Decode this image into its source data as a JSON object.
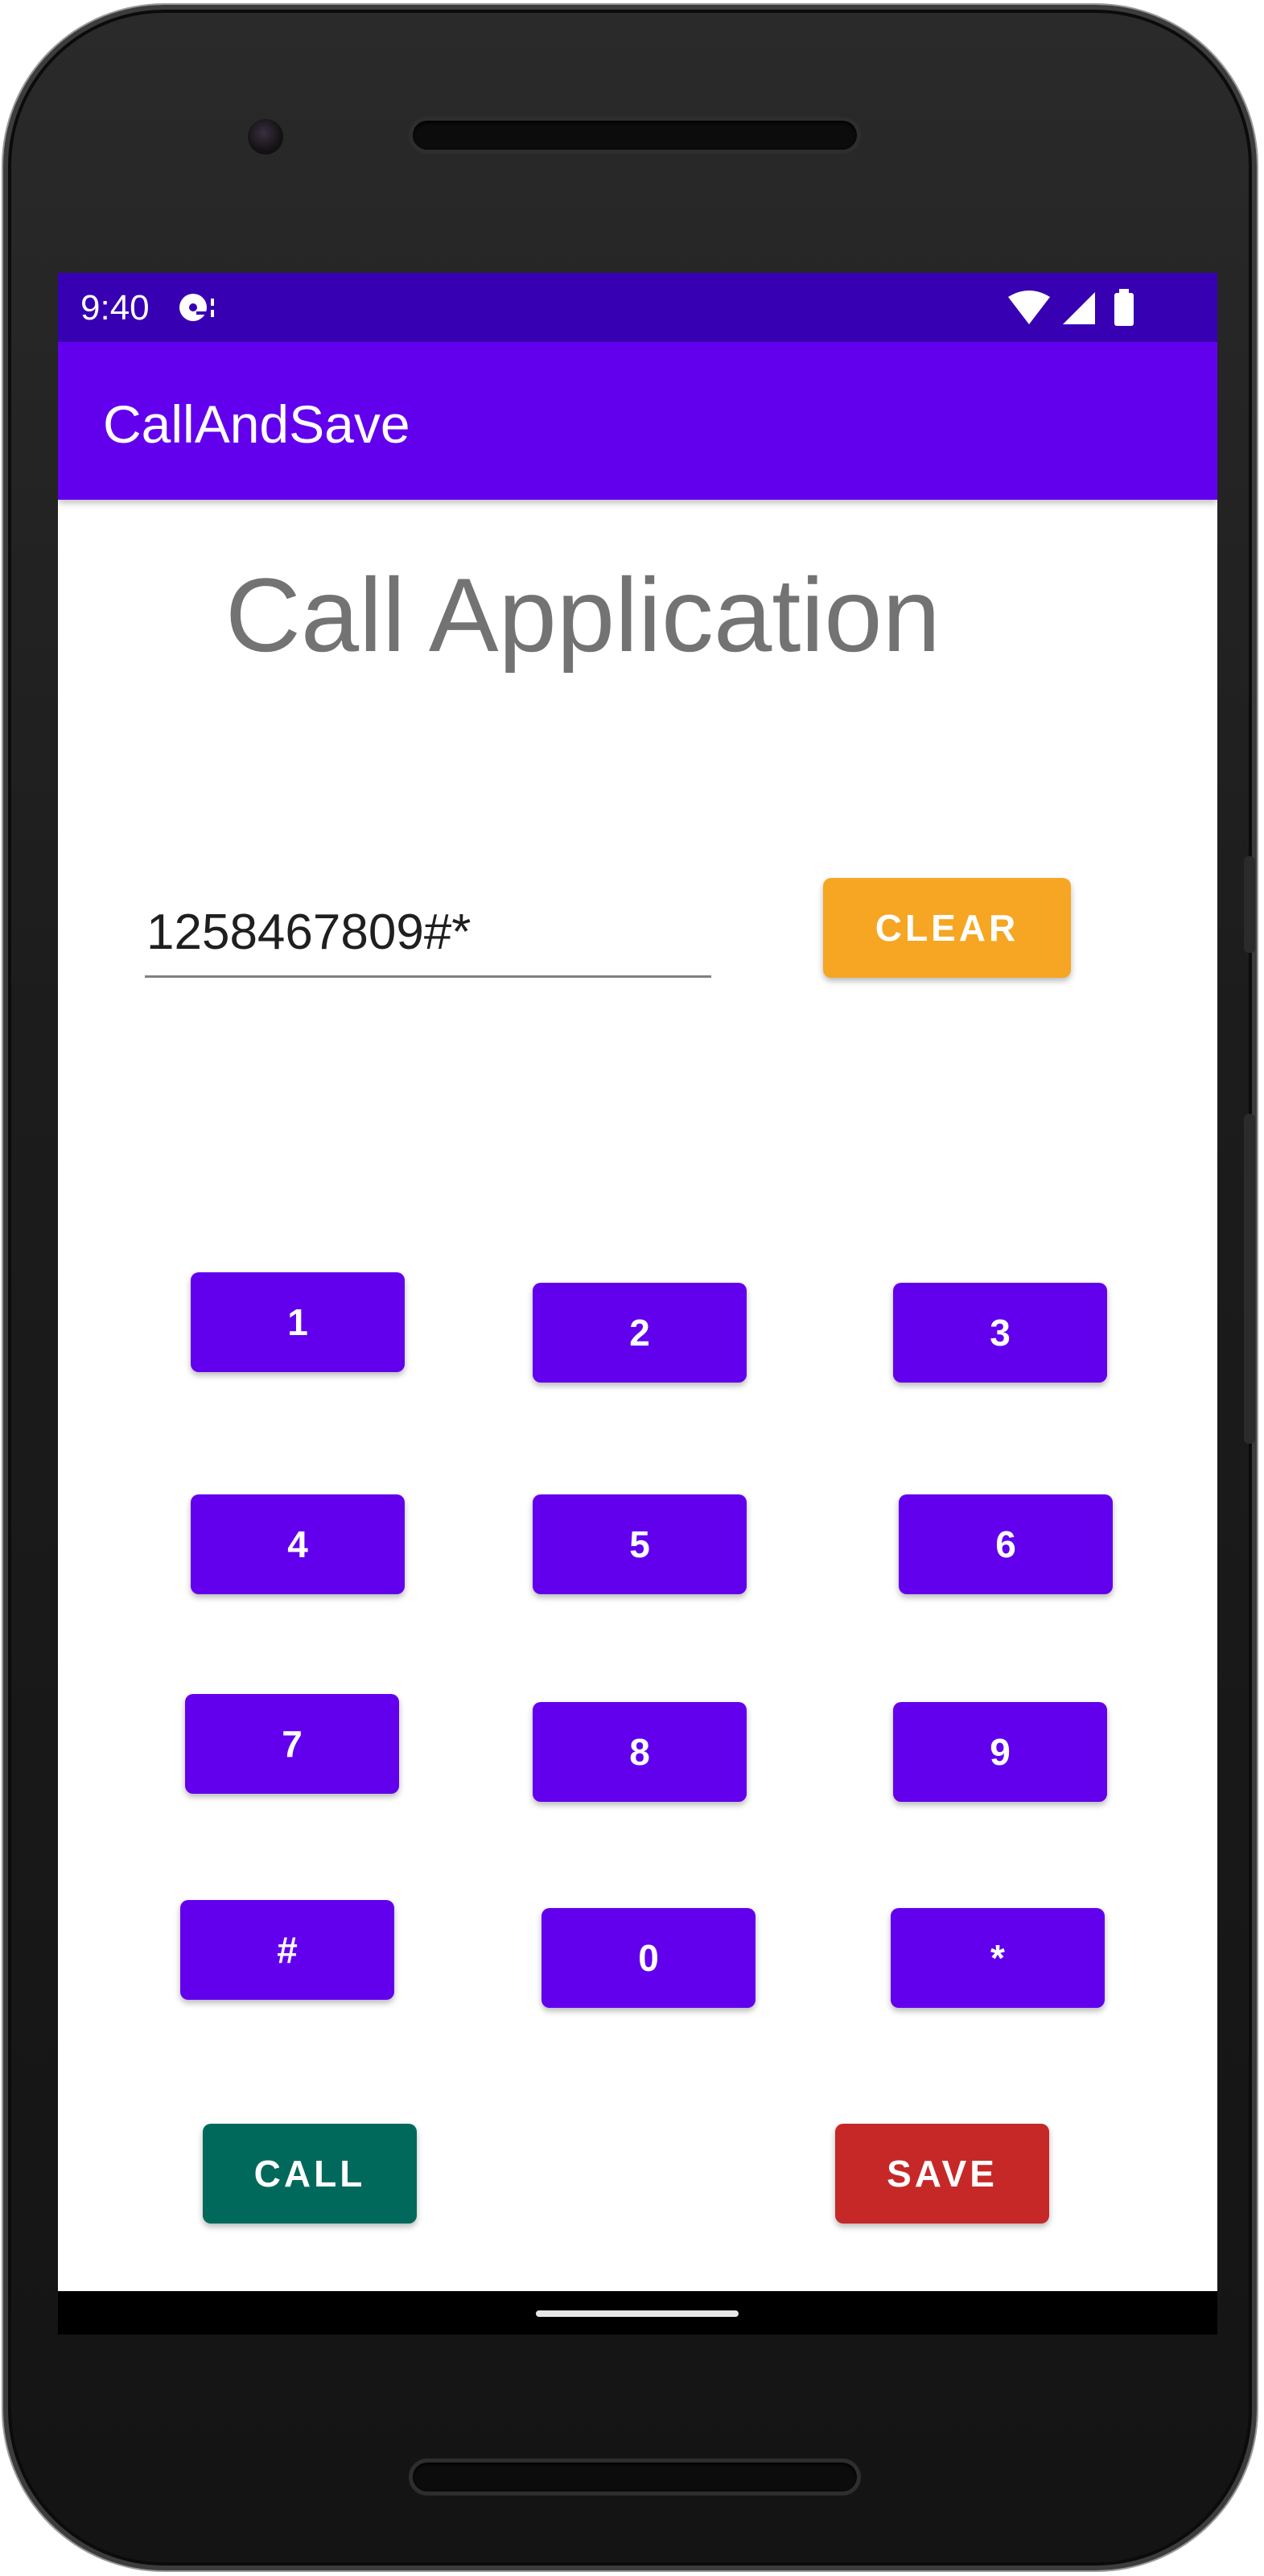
{
  "status_bar": {
    "time": "9:40",
    "notification_icon": "media-icon",
    "icons": [
      "wifi-icon",
      "signal-icon",
      "battery-icon"
    ]
  },
  "app_bar": {
    "title": "CallAndSave"
  },
  "main": {
    "heading": "Call Application",
    "phone_input_value": "1258467809#*",
    "clear_label": "CLEAR",
    "keypad": [
      "1",
      "2",
      "3",
      "4",
      "5",
      "6",
      "7",
      "8",
      "9",
      "#",
      "0",
      "*"
    ],
    "call_label": "CALL",
    "save_label": "SAVE"
  },
  "colors": {
    "primary": "#6200ee",
    "primary_dark": "#3700b3",
    "clear": "#f6a623",
    "call": "#00695c",
    "save": "#c62828"
  }
}
